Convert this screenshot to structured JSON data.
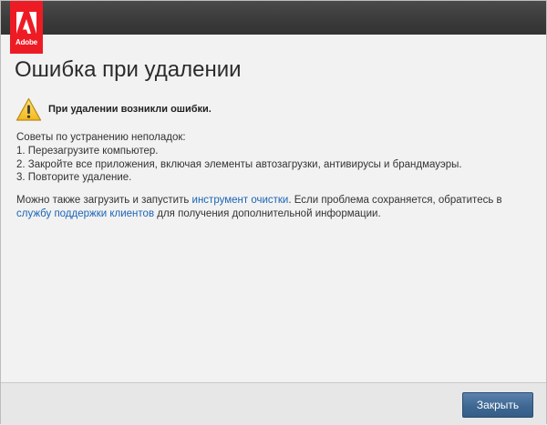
{
  "brand": {
    "logo_text": "Adobe",
    "logo_color": "#ed1c24"
  },
  "dialog": {
    "title": "Ошибка при удалении",
    "warning_icon": "warning-triangle-icon",
    "warning_message": "При удалении возникли ошибки.",
    "tips": {
      "heading": "Советы по устранению неполадок:",
      "items": [
        "1. Перезагрузите компьютер.",
        "2. Закройте все приложения, включая элементы автозагрузки, антивирусы и брандмауэры.",
        "3. Повторите удаление."
      ]
    },
    "info": {
      "part1": "Можно также загрузить и запустить ",
      "cleanup_link": "инструмент очистки",
      "part2": ". Если проблема сохраняется, обратитесь в ",
      "support_link": "службу поддержки клиентов",
      "part3": " для получения дополнительной информации."
    },
    "link_color": "#1b65b6"
  },
  "footer": {
    "close_label": "Закрыть"
  }
}
